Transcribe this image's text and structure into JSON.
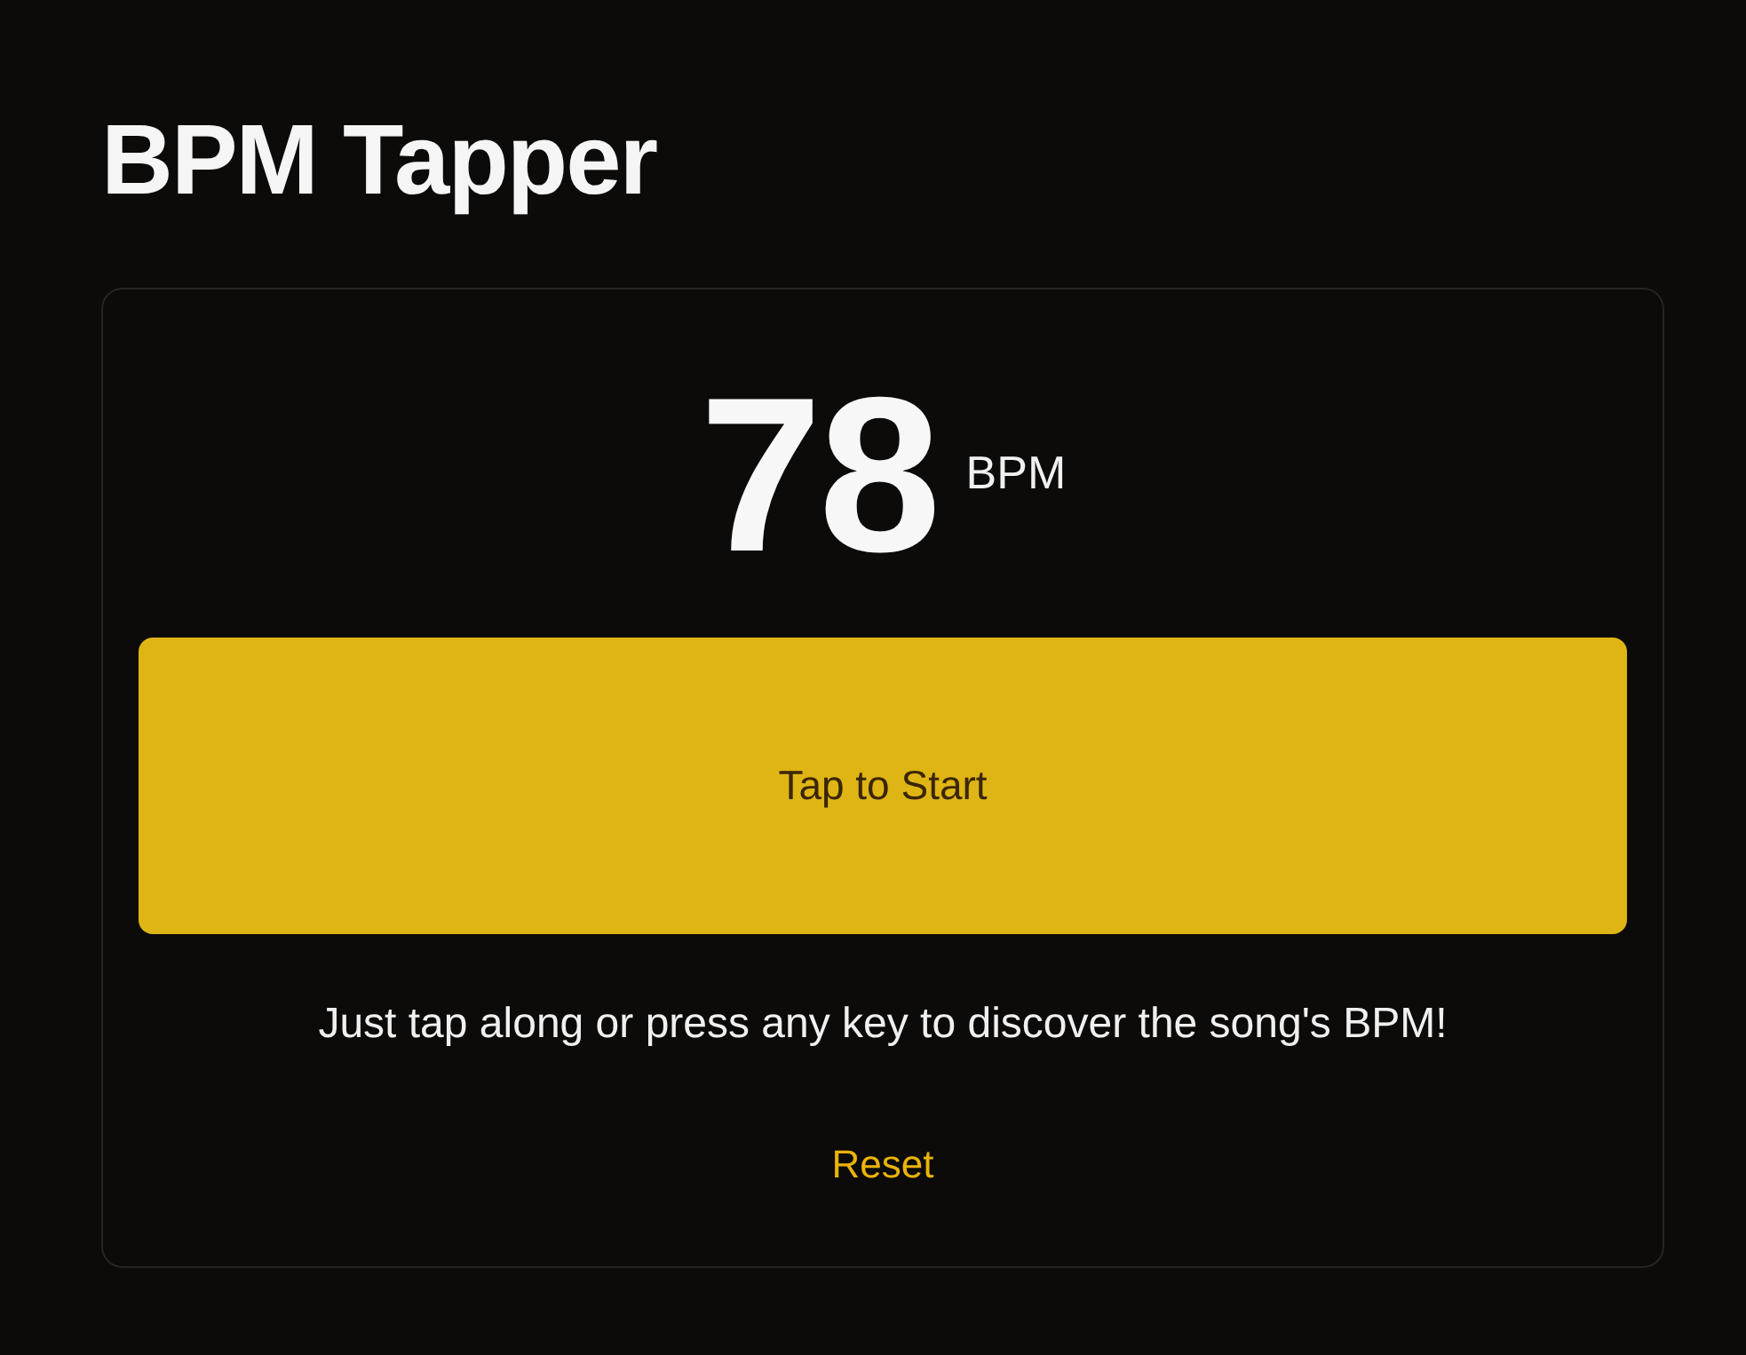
{
  "title": "BPM Tapper",
  "reading": {
    "value": "78",
    "unit": "BPM"
  },
  "tap_button": {
    "label": "Tap to Start"
  },
  "hint": "Just tap along or press any key to discover the song's BPM!",
  "reset_link": {
    "label": "Reset"
  }
}
